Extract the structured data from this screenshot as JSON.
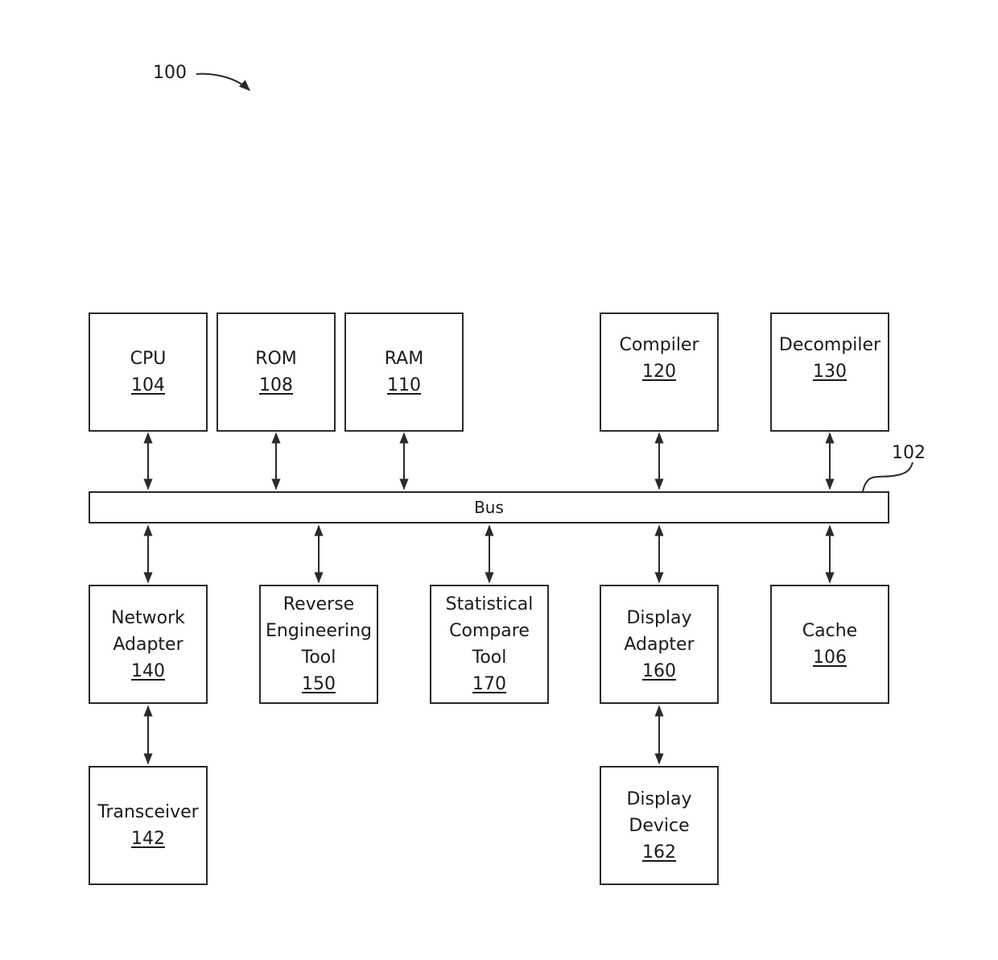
{
  "figure": {
    "ref": "100",
    "bus": {
      "label": "Bus",
      "ref": "102"
    }
  },
  "blocks": {
    "cpu": {
      "lines": [
        "CPU"
      ],
      "ref": "104"
    },
    "rom": {
      "lines": [
        "ROM"
      ],
      "ref": "108"
    },
    "ram": {
      "lines": [
        "RAM"
      ],
      "ref": "110"
    },
    "compiler": {
      "lines": [
        "Compiler"
      ],
      "ref": "120"
    },
    "decompiler": {
      "lines": [
        "Decompiler"
      ],
      "ref": "130"
    },
    "network_adapter": {
      "lines": [
        "Network",
        "Adapter"
      ],
      "ref": "140"
    },
    "reverse_tool": {
      "lines": [
        "Reverse",
        "Engineering",
        "Tool"
      ],
      "ref": "150"
    },
    "statistical_tool": {
      "lines": [
        "Statistical",
        "Compare",
        "Tool"
      ],
      "ref": "170"
    },
    "display_adapter": {
      "lines": [
        "Display",
        "Adapter"
      ],
      "ref": "160"
    },
    "cache": {
      "lines": [
        "Cache"
      ],
      "ref": "106"
    },
    "transceiver": {
      "lines": [
        "Transceiver"
      ],
      "ref": "142"
    },
    "display_device": {
      "lines": [
        "Display",
        "Device"
      ],
      "ref": "162"
    }
  },
  "connections": [
    {
      "from": "cpu",
      "to": "bus",
      "type": "bidirectional"
    },
    {
      "from": "rom",
      "to": "bus",
      "type": "bidirectional"
    },
    {
      "from": "ram",
      "to": "bus",
      "type": "bidirectional"
    },
    {
      "from": "compiler",
      "to": "bus",
      "type": "bidirectional"
    },
    {
      "from": "decompiler",
      "to": "bus",
      "type": "bidirectional"
    },
    {
      "from": "bus",
      "to": "network_adapter",
      "type": "bidirectional"
    },
    {
      "from": "bus",
      "to": "reverse_tool",
      "type": "bidirectional"
    },
    {
      "from": "bus",
      "to": "statistical_tool",
      "type": "bidirectional"
    },
    {
      "from": "bus",
      "to": "display_adapter",
      "type": "bidirectional"
    },
    {
      "from": "bus",
      "to": "cache",
      "type": "bidirectional"
    },
    {
      "from": "network_adapter",
      "to": "transceiver",
      "type": "bidirectional"
    },
    {
      "from": "display_adapter",
      "to": "display_device",
      "type": "bidirectional"
    }
  ]
}
